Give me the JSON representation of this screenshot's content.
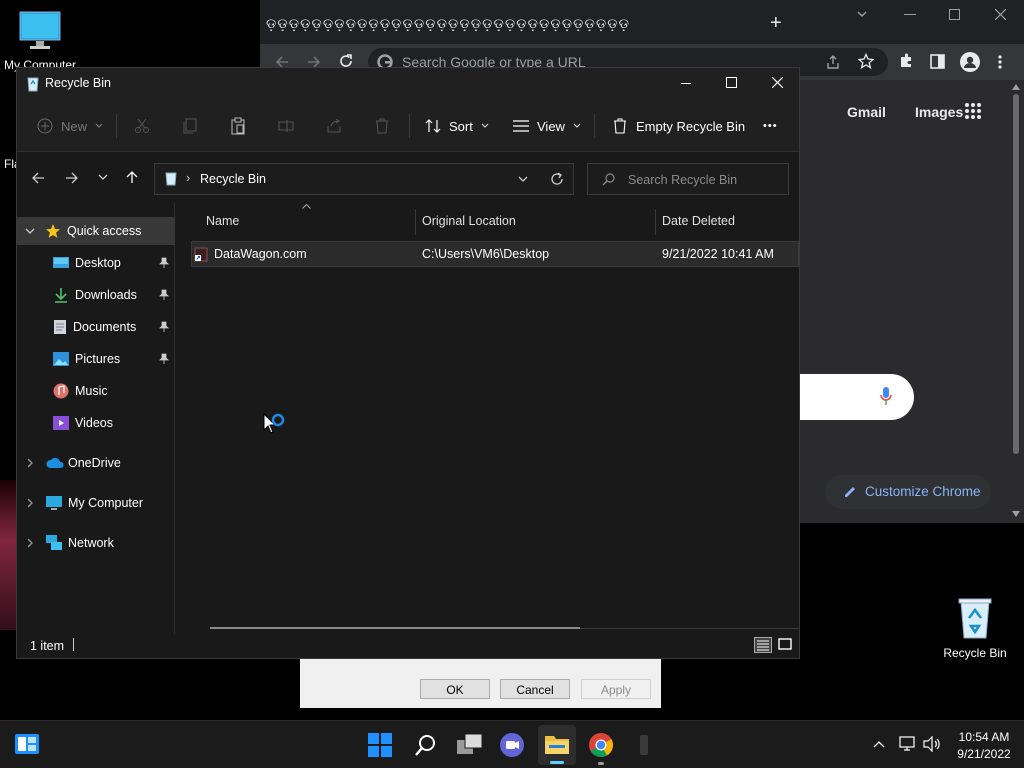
{
  "desktop": {
    "icons": [
      {
        "label": "My Computer"
      },
      {
        "label": "Recycle Bin"
      }
    ],
    "partial_label": "Fla"
  },
  "chrome": {
    "tab_title": "ଡ଼ଡ଼ଡ଼ଡ଼ଡ଼ଡ଼ଡ଼ଡ଼ଡ଼ଡ଼ଡ଼ଡ଼ଡ଼ଡ଼ଡ଼ଡ଼ଡ଼ଡ଼ଡ଼ଡ଼ଡ଼ଡ଼ଡ଼ଡ଼ଡ଼ଡ଼ଡ଼ଡ଼ଡ଼ଡ଼ଡ଼ଡ଼",
    "new_tab": "+",
    "omnibox_placeholder": "Search Google or type a URL",
    "links": {
      "gmail": "Gmail",
      "images": "Images"
    },
    "customize": "Customize Chrome"
  },
  "explorer": {
    "title": "Recycle Bin",
    "toolbar": {
      "new": "New",
      "sort": "Sort",
      "view": "View",
      "empty": "Empty Recycle Bin",
      "more": "•••"
    },
    "address": {
      "separator": "›",
      "location": "Recycle Bin"
    },
    "search_placeholder": "Search Recycle Bin",
    "nav": {
      "quick_access": "Quick access",
      "desktop": "Desktop",
      "downloads": "Downloads",
      "documents": "Documents",
      "pictures": "Pictures",
      "music": "Music",
      "videos": "Videos",
      "onedrive": "OneDrive",
      "my_computer": "My Computer",
      "network": "Network"
    },
    "columns": {
      "name": "Name",
      "original_location": "Original Location",
      "date_deleted": "Date Deleted"
    },
    "files": [
      {
        "name": "DataWagon.com",
        "original_location": "C:\\Users\\VM6\\Desktop",
        "date_deleted": "9/21/2022 10:41 AM"
      }
    ],
    "status": "1 item"
  },
  "dialog": {
    "ok": "OK",
    "cancel": "Cancel",
    "apply": "Apply"
  },
  "taskbar": {
    "time": "10:54 AM",
    "date": "9/21/2022"
  },
  "colors": {
    "accent": "#0078d4",
    "chrome_link": "#8ab4f8",
    "folder_yellow": "#f0c040"
  }
}
